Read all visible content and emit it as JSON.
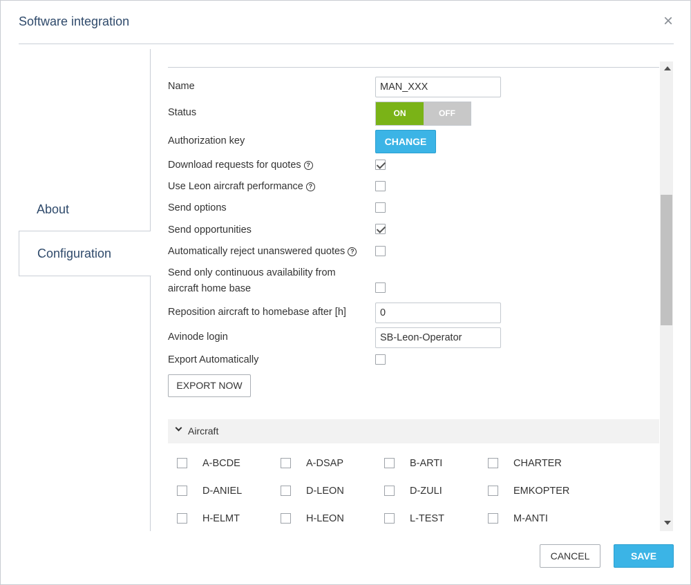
{
  "dialog": {
    "title": "Software integration",
    "close_icon": "close-icon"
  },
  "sidebar": {
    "items": [
      {
        "label": "About",
        "active": false
      },
      {
        "label": "Configuration",
        "active": true
      }
    ]
  },
  "form": {
    "name": {
      "label": "Name",
      "value": "MAN_XXX"
    },
    "status": {
      "label": "Status",
      "on_label": "ON",
      "off_label": "OFF",
      "value": "ON"
    },
    "authorization_key": {
      "label": "Authorization key",
      "button": "CHANGE"
    },
    "download_requests": {
      "label": "Download requests for quotes",
      "checked": true,
      "help_icon": "help-icon"
    },
    "use_leon_performance": {
      "label": "Use Leon aircraft performance",
      "checked": false,
      "help_icon": "help-icon"
    },
    "send_options": {
      "label": "Send options",
      "checked": false
    },
    "send_opportunities": {
      "label": "Send opportunities",
      "checked": true
    },
    "auto_reject": {
      "label": "Automatically reject unanswered quotes",
      "checked": false,
      "help_icon": "help-icon"
    },
    "continuous_availability": {
      "label_line1": "Send only continuous availability from",
      "label_line2": "aircraft home base",
      "checked": false
    },
    "reposition": {
      "label": "Reposition aircraft to homebase after [h]",
      "value": "0"
    },
    "avinode_login": {
      "label": "Avinode login",
      "value": "SB-Leon-Operator"
    },
    "export_automatically": {
      "label": "Export Automatically",
      "checked": false
    },
    "export_now_button": "EXPORT NOW"
  },
  "aircraft_section": {
    "title": "Aircraft",
    "expanded": true,
    "items": [
      "A-BCDE",
      "A-DSAP",
      "B-ARTI",
      "CHARTER",
      "D-ANIEL",
      "D-LEON",
      "D-ZULI",
      "EMKOPTER",
      "H-ELMT",
      "H-LEON",
      "L-TEST",
      "M-ANTI"
    ]
  },
  "footer": {
    "cancel": "CANCEL",
    "save": "SAVE"
  },
  "colors": {
    "toggle_on": "#7ab317",
    "toggle_off": "#c8c8c8",
    "primary_button": "#3bb4e6",
    "title_text": "#2f4a6b"
  }
}
